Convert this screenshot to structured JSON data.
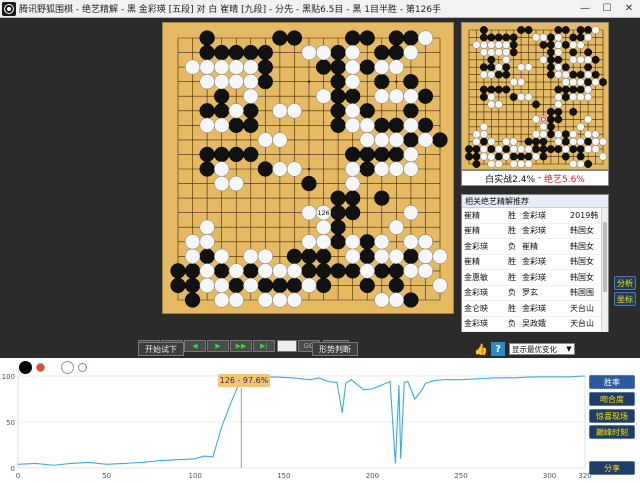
{
  "window": {
    "app_name": "腾讯野狐围棋",
    "title": "腾讯野狐围棋 - 绝艺精解 - 黑 金彩瑛 [五段] 对 白 崔晴 [九段] - 分先 - 黑贴6.5目 - 黑 1目半胜 - 第126手",
    "minimize": "—",
    "maximize": "☐",
    "close": "✕"
  },
  "board": {
    "size": 19,
    "black": [
      [
        2,
        0
      ],
      [
        2,
        1
      ],
      [
        3,
        1
      ],
      [
        4,
        1
      ],
      [
        5,
        1
      ],
      [
        6,
        1
      ],
      [
        6,
        2
      ],
      [
        7,
        0
      ],
      [
        8,
        0
      ],
      [
        6,
        3
      ],
      [
        2,
        5
      ],
      [
        3,
        5
      ],
      [
        3,
        4
      ],
      [
        4,
        6
      ],
      [
        5,
        5
      ],
      [
        5,
        6
      ],
      [
        10,
        2
      ],
      [
        11,
        1
      ],
      [
        11,
        2
      ],
      [
        11,
        3
      ],
      [
        11,
        4
      ],
      [
        11,
        5
      ],
      [
        11,
        6
      ],
      [
        12,
        0
      ],
      [
        13,
        0
      ],
      [
        12,
        4
      ],
      [
        13,
        2
      ],
      [
        14,
        1
      ],
      [
        15,
        0
      ],
      [
        16,
        0
      ],
      [
        15,
        1
      ],
      [
        13,
        5
      ],
      [
        14,
        6
      ],
      [
        15,
        6
      ],
      [
        16,
        5
      ],
      [
        17,
        4
      ],
      [
        16,
        3
      ],
      [
        14,
        3
      ],
      [
        2,
        8
      ],
      [
        3,
        8
      ],
      [
        4,
        8
      ],
      [
        5,
        8
      ],
      [
        6,
        9
      ],
      [
        2,
        9
      ],
      [
        9,
        10
      ],
      [
        12,
        8
      ],
      [
        13,
        8
      ],
      [
        14,
        8
      ],
      [
        15,
        8
      ],
      [
        13,
        9
      ],
      [
        14,
        11
      ],
      [
        16,
        7
      ],
      [
        17,
        6
      ],
      [
        18,
        7
      ],
      [
        11,
        13
      ],
      [
        11,
        14
      ],
      [
        10,
        15
      ],
      [
        11,
        16
      ],
      [
        12,
        16
      ],
      [
        13,
        17
      ],
      [
        10,
        17
      ],
      [
        10,
        16
      ],
      [
        9,
        15
      ],
      [
        12,
        12
      ],
      [
        11,
        12
      ],
      [
        12,
        11
      ],
      [
        11,
        11
      ],
      [
        1,
        16
      ],
      [
        0,
        16
      ],
      [
        0,
        17
      ],
      [
        1,
        17
      ],
      [
        1,
        18
      ],
      [
        2,
        15
      ],
      [
        3,
        16
      ],
      [
        4,
        17
      ],
      [
        5,
        16
      ],
      [
        6,
        17
      ],
      [
        7,
        17
      ],
      [
        8,
        15
      ],
      [
        9,
        16
      ],
      [
        8,
        17
      ],
      [
        13,
        14
      ],
      [
        14,
        16
      ],
      [
        15,
        16
      ],
      [
        16,
        15
      ],
      [
        17,
        14
      ],
      [
        16,
        18
      ],
      [
        15,
        17
      ],
      [
        13,
        15
      ]
    ],
    "white": [
      [
        1,
        2
      ],
      [
        2,
        2
      ],
      [
        3,
        2
      ],
      [
        4,
        2
      ],
      [
        5,
        2
      ],
      [
        2,
        3
      ],
      [
        3,
        3
      ],
      [
        4,
        3
      ],
      [
        5,
        3
      ],
      [
        7,
        5
      ],
      [
        8,
        5
      ],
      [
        5,
        4
      ],
      [
        4,
        5
      ],
      [
        2,
        6
      ],
      [
        3,
        6
      ],
      [
        7,
        7
      ],
      [
        6,
        7
      ],
      [
        9,
        1
      ],
      [
        10,
        1
      ],
      [
        12,
        1
      ],
      [
        12,
        2
      ],
      [
        12,
        3
      ],
      [
        10,
        4
      ],
      [
        12,
        5
      ],
      [
        12,
        6
      ],
      [
        14,
        2
      ],
      [
        15,
        2
      ],
      [
        16,
        1
      ],
      [
        17,
        0
      ],
      [
        14,
        4
      ],
      [
        15,
        4
      ],
      [
        16,
        4
      ],
      [
        13,
        6
      ],
      [
        13,
        7
      ],
      [
        14,
        7
      ],
      [
        15,
        7
      ],
      [
        16,
        8
      ],
      [
        15,
        9
      ],
      [
        16,
        9
      ],
      [
        16,
        6
      ],
      [
        17,
        7
      ],
      [
        14,
        9
      ],
      [
        12,
        9
      ],
      [
        12,
        10
      ],
      [
        3,
        9
      ],
      [
        3,
        10
      ],
      [
        4,
        10
      ],
      [
        8,
        9
      ],
      [
        7,
        9
      ],
      [
        2,
        14
      ],
      [
        1,
        15
      ],
      [
        1,
        14
      ],
      [
        2,
        16
      ],
      [
        3,
        15
      ],
      [
        3,
        17
      ],
      [
        4,
        16
      ],
      [
        5,
        15
      ],
      [
        6,
        16
      ],
      [
        6,
        15
      ],
      [
        5,
        17
      ],
      [
        7,
        16
      ],
      [
        8,
        16
      ],
      [
        9,
        14
      ],
      [
        10,
        14
      ],
      [
        10,
        13
      ],
      [
        12,
        14
      ],
      [
        12,
        15
      ],
      [
        13,
        16
      ],
      [
        14,
        15
      ],
      [
        14,
        14
      ],
      [
        15,
        15
      ],
      [
        15,
        13
      ],
      [
        16,
        14
      ],
      [
        16,
        12
      ],
      [
        17,
        14
      ],
      [
        17,
        15
      ],
      [
        16,
        16
      ],
      [
        18,
        15
      ],
      [
        17,
        16
      ],
      [
        18,
        17
      ],
      [
        15,
        18
      ],
      [
        14,
        18
      ],
      [
        9,
        17
      ],
      [
        7,
        18
      ],
      [
        6,
        18
      ],
      [
        8,
        18
      ],
      [
        4,
        18
      ],
      [
        3,
        18
      ],
      [
        2,
        17
      ],
      [
        2,
        13
      ],
      [
        9,
        12
      ],
      [
        10,
        12
      ]
    ],
    "last_move": [
      10,
      12
    ],
    "last_move_label": "126"
  },
  "winrate_bar": {
    "white_label": "白实战2.4%",
    "separator": " - ",
    "ai_label": "绝艺5.6%"
  },
  "games_panel": {
    "header": "相关绝艺精解推荐",
    "rows": [
      {
        "player_a": "崔精",
        "result": "胜",
        "player_b": "金彩瑛",
        "event": "2019韩"
      },
      {
        "player_a": "崔精",
        "result": "胜",
        "player_b": "金彩瑛",
        "event": "韩国女"
      },
      {
        "player_a": "金彩瑛",
        "result": "负",
        "player_b": "崔精",
        "event": "韩国女"
      },
      {
        "player_a": "崔精",
        "result": "胜",
        "player_b": "金彩瑛",
        "event": "韩国女"
      },
      {
        "player_a": "金惠敏",
        "result": "胜",
        "player_b": "金彩瑛",
        "event": "韩国女"
      },
      {
        "player_a": "金彩瑛",
        "result": "负",
        "player_b": "罗玄",
        "event": "韩国围"
      },
      {
        "player_a": "金仑映",
        "result": "胜",
        "player_b": "金彩瑛",
        "event": "天台山"
      },
      {
        "player_a": "金彩瑛",
        "result": "负",
        "player_b": "吴政娥",
        "event": "天台山"
      }
    ]
  },
  "side_buttons": {
    "upper": "分析",
    "lower": "坐标"
  },
  "nav": {
    "first": "|◀",
    "prev10": "◀◀",
    "prev": "◀",
    "next": "▶",
    "next10": "▶▶",
    "last": "▶|",
    "go": "GO",
    "auto_play": "自动"
  },
  "actions": {
    "trial": "开始试下",
    "judge": "形势判断",
    "thumb": "👍",
    "help": "?",
    "display_select": "显示最优变化",
    "display_arrow": "▼"
  },
  "chart": {
    "tooltip": "126 - 97.6%",
    "tabs": [
      "胜率",
      "吻合度",
      "惊喜现场",
      "巅峰时刻"
    ],
    "share": "分享",
    "icons": [
      "black-stone-icon",
      "red-dot-icon",
      "white-stone-icon",
      "blue-ring-icon"
    ],
    "colors": {
      "line": "#3fa9e0",
      "cursor": "#888888",
      "grid": "#ececec"
    }
  },
  "chart_data": {
    "type": "line",
    "title": "",
    "xlabel": "",
    "ylabel": "",
    "xlim": [
      0,
      320
    ],
    "ylim": [
      0,
      100
    ],
    "x_ticks": [
      0,
      50,
      100,
      150,
      200,
      250,
      300,
      320
    ],
    "y_ticks": [
      0,
      50,
      100
    ],
    "series": [
      {
        "x": [
          0,
          10,
          20,
          30,
          40,
          50,
          60,
          70,
          80,
          90,
          100,
          105,
          110,
          115,
          120,
          126,
          135,
          145,
          155,
          160,
          165,
          170,
          175,
          180,
          183,
          185,
          188,
          190,
          195,
          200,
          205,
          210,
          213,
          215,
          216,
          218,
          220,
          224,
          228,
          230,
          235,
          240,
          250,
          260,
          270,
          280,
          290,
          300,
          310,
          320
        ],
        "y": [
          4,
          5,
          3,
          5,
          6,
          4,
          5,
          6,
          8,
          9,
          10,
          13,
          12,
          45,
          70,
          97.6,
          98,
          99,
          98,
          97,
          96,
          98,
          94,
          93,
          60,
          92,
          96,
          93,
          85,
          86,
          90,
          94,
          5,
          90,
          10,
          93,
          94,
          75,
          85,
          92,
          95,
          96,
          96,
          97,
          98,
          98,
          99,
          99,
          99,
          100
        ]
      }
    ]
  }
}
